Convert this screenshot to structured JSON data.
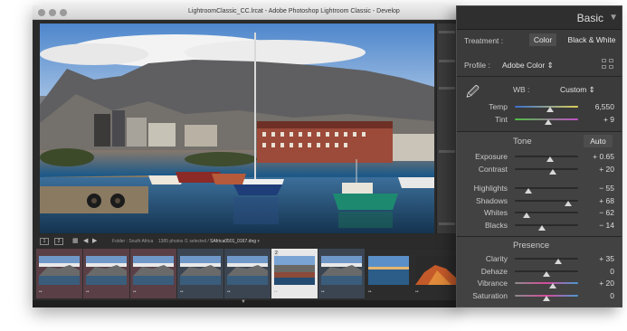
{
  "window": {
    "title": "LightroomClassic_CC.lrcat - Adobe Photoshop Lightroom Classic - Develop"
  },
  "filmstrip": {
    "page_buttons": [
      "1",
      "2"
    ],
    "info_prefix": "Folder : South Africa",
    "info_counts": "1385 photos /1 selected /",
    "info_file": "SAfrica0501_0167.dng",
    "selected_number": "2",
    "thumbs": [
      {
        "style": "mountain",
        "tint": "#5a3f46"
      },
      {
        "style": "mountain",
        "tint": "#5a3f46"
      },
      {
        "style": "mountain",
        "tint": "#5a3f46"
      },
      {
        "style": "mountain",
        "tint": "#3b4552"
      },
      {
        "style": "mountain",
        "tint": "#3b4552"
      },
      {
        "style": "harbor",
        "tint": "#e8e8e8"
      },
      {
        "style": "mountain",
        "tint": "#3b4552"
      },
      {
        "style": "sea",
        "tint": "#2c2c2c"
      },
      {
        "style": "rock",
        "tint": "#2c2c2c"
      }
    ]
  },
  "panel": {
    "title": "Basic",
    "treatment_label": "Treatment :",
    "treatment_color": "Color",
    "treatment_bw": "Black & White",
    "profile_label": "Profile :",
    "profile_value": "Adobe Color",
    "wb_label": "WB :",
    "wb_value": "Custom",
    "temp": {
      "label": "Temp",
      "value": "6,550"
    },
    "tint": {
      "label": "Tint",
      "value": "+ 9"
    },
    "tone_label": "Tone",
    "auto_label": "Auto",
    "tone_sliders": [
      {
        "label": "Exposure",
        "value": "+ 0.65"
      },
      {
        "label": "Contrast",
        "value": "+ 20"
      },
      {
        "label": "Highlights",
        "value": "− 55"
      },
      {
        "label": "Shadows",
        "value": "+ 68"
      },
      {
        "label": "Whites",
        "value": "− 62"
      },
      {
        "label": "Blacks",
        "value": "− 14"
      }
    ],
    "presence_label": "Presence",
    "presence_sliders": [
      {
        "label": "Clarity",
        "value": "+ 35"
      },
      {
        "label": "Dehaze",
        "value": "0"
      },
      {
        "label": "Vibrance",
        "value": "+ 20"
      },
      {
        "label": "Saturation",
        "value": "0"
      }
    ],
    "slider_levels": {
      "temp": 0.55,
      "tint": 0.53,
      "exposure": 0.56,
      "contrast": 0.6,
      "highlights": 0.22,
      "shadows": 0.84,
      "whites": 0.19,
      "blacks": 0.43,
      "clarity": 0.68,
      "dehaze": 0.5,
      "vibrance": 0.6,
      "saturation": 0.5
    }
  }
}
